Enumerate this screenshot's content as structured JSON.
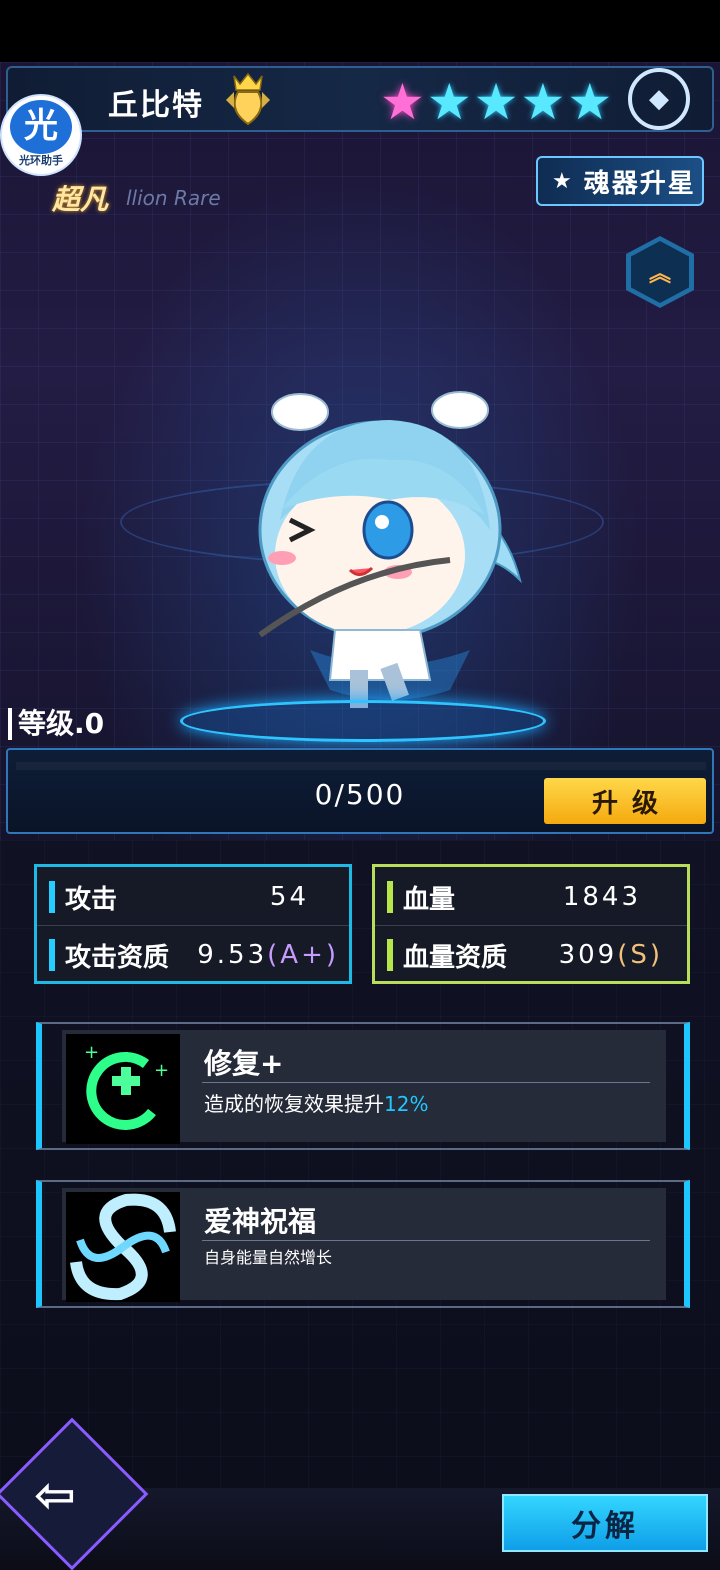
{
  "hero": {
    "name": "丘比特",
    "stars_total": 5,
    "stars_active": 1,
    "rarity_cn": "超凡",
    "rarity_en": "llion Rare"
  },
  "helper": {
    "char": "光",
    "label": "光环助手"
  },
  "buttons": {
    "upstar": "魂器升星",
    "upgrade": "升级",
    "decompose": "分解"
  },
  "level": {
    "label": "等级.0",
    "xp": "0/500",
    "progress": 0
  },
  "stats": {
    "attack_label": "攻击",
    "attack_value": "54",
    "attack_quality_label": "攻击资质",
    "attack_quality_value": "9.53",
    "attack_grade": "(A+)",
    "hp_label": "血量",
    "hp_value": "1843",
    "hp_quality_label": "血量资质",
    "hp_quality_value": "309",
    "hp_grade": "(S)"
  },
  "skills": [
    {
      "name": "修复+",
      "desc_prefix": "造成的恢复效果提升",
      "desc_highlight": "12%"
    },
    {
      "name": "爱神祝福",
      "desc_prefix": "自身能量自然增长",
      "desc_highlight": ""
    }
  ],
  "colors": {
    "star_active": "#ff6fd5",
    "star_inactive": "#59e9ff",
    "upgrade_button": "#f5a90e",
    "attack_accent": "#1fb9e6",
    "hp_accent": "#b7dd5a"
  }
}
